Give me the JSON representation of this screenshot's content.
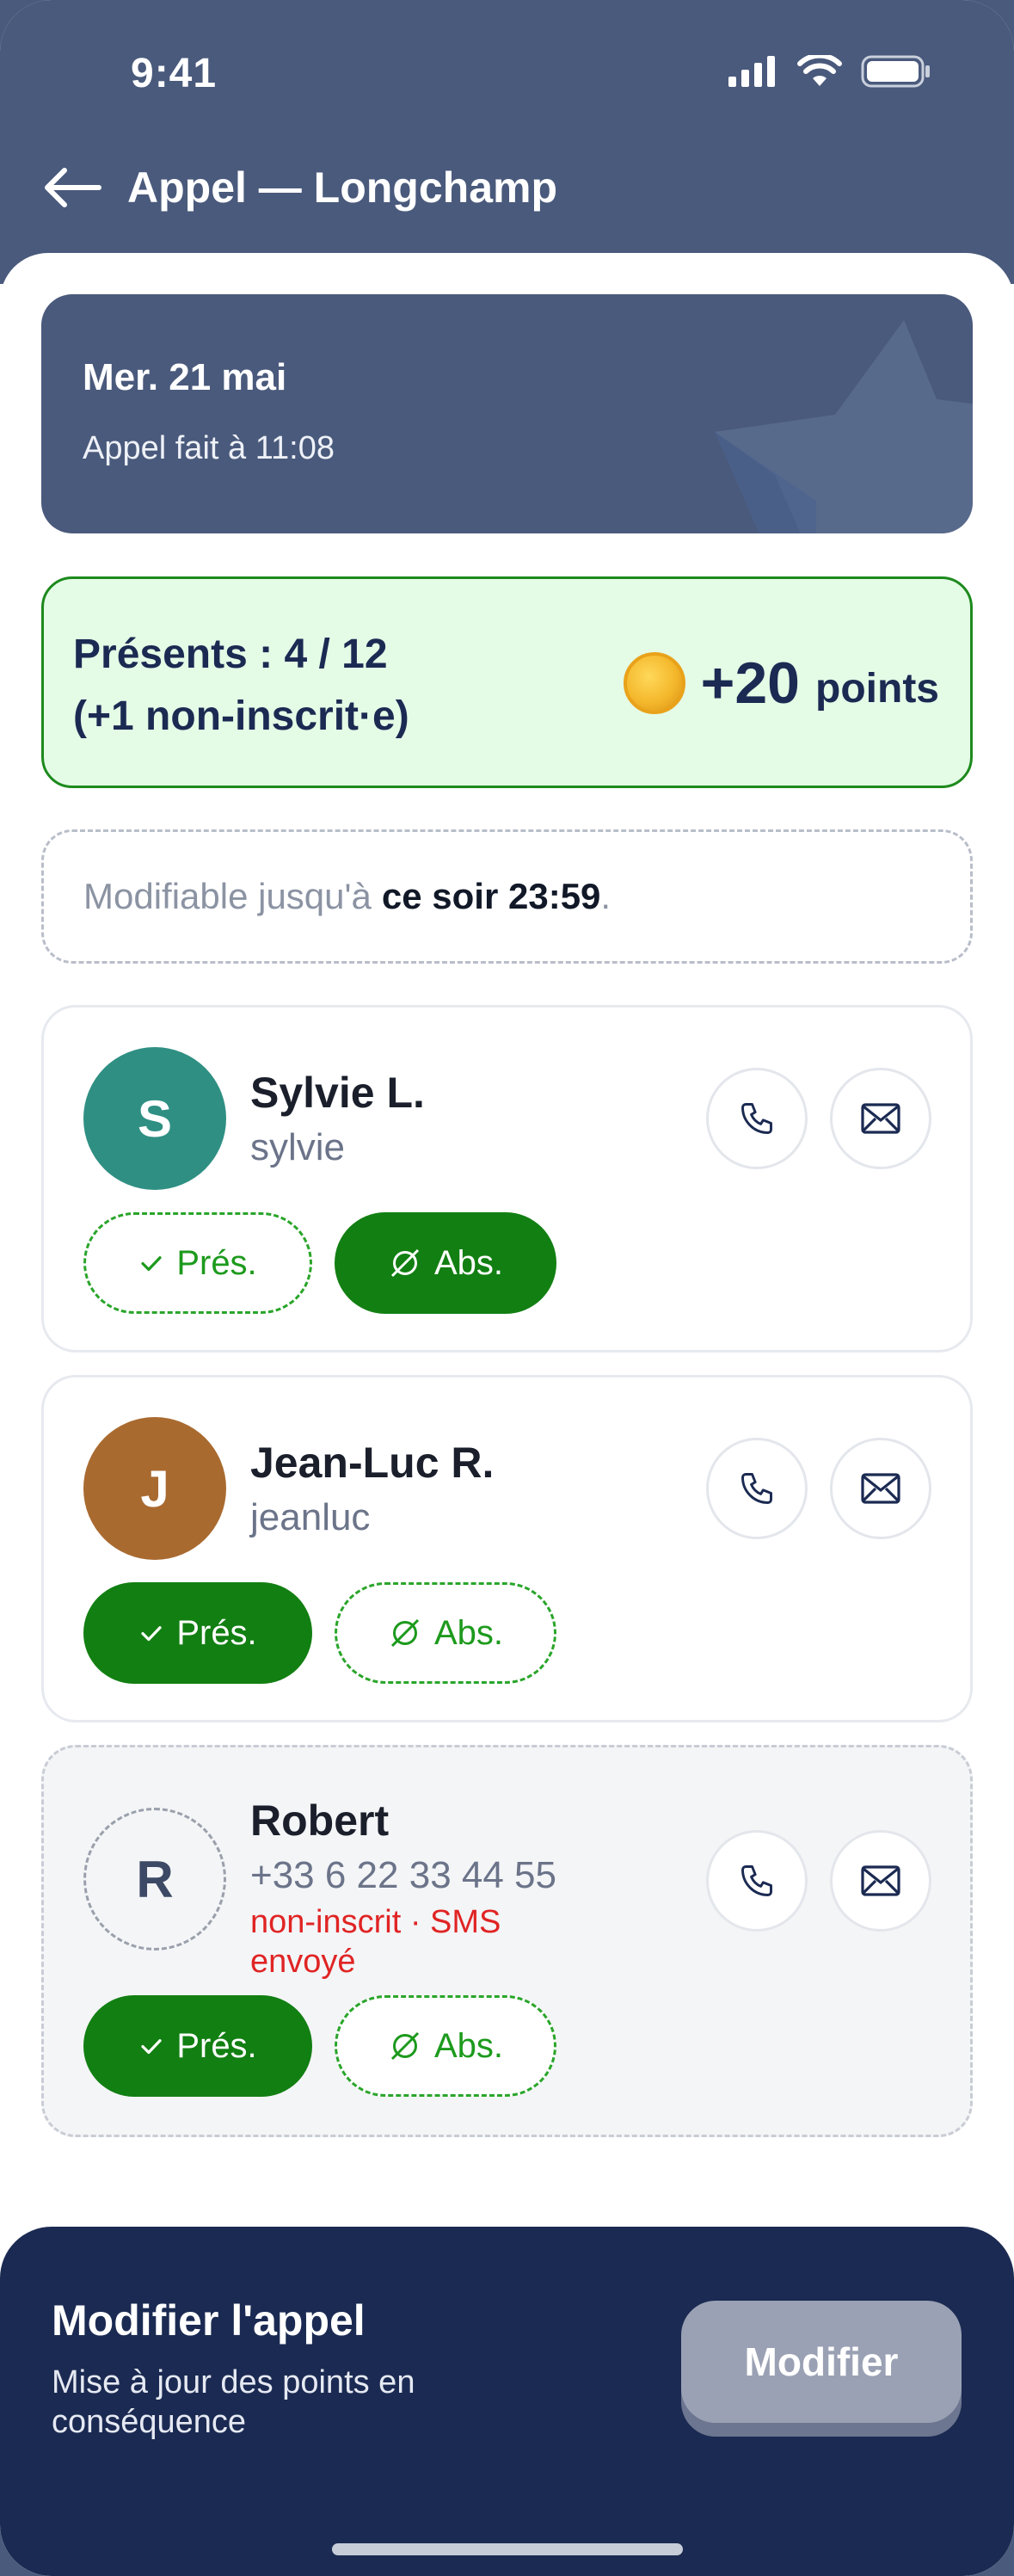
{
  "status_bar": {
    "time": "9:41"
  },
  "header": {
    "title": "Appel — Longchamp"
  },
  "date_card": {
    "date": "Mer. 21 mai",
    "subtitle": "Appel fait à 11:08"
  },
  "summary": {
    "present_line": "Présents : 4 / 12",
    "extra_line": "(+1 non-inscrit·e)",
    "points_value": "+20",
    "points_unit": "points"
  },
  "note": {
    "prefix": "Modifiable jusqu'à",
    "deadline": "ce soir 23:59",
    "suffix": "."
  },
  "people": [
    {
      "initial": "S",
      "name": "Sylvie L.",
      "handle": "sylvie",
      "status": "absent",
      "avatar_color": "#2f8f83"
    },
    {
      "initial": "J",
      "name": "Jean-Luc R.",
      "handle": "jeanluc",
      "status": "present",
      "avatar_color": "#a96a30"
    },
    {
      "initial": "R",
      "name": "Robert",
      "handle": "+33 6 22 33 44 55",
      "warning": "non-inscrit · SMS envoyé",
      "status": "present"
    }
  ],
  "buttons": {
    "present": "Prés.",
    "absent": "Abs."
  },
  "sheet": {
    "title": "Modifier l'appel",
    "subtitle": "Mise à jour des points en conséquence",
    "button": "Modifier"
  },
  "colors": {
    "header_bg": "#4a5a7c",
    "accent_green": "#127f12",
    "sheet_bg": "#1b2a52",
    "warning_red": "#e02424"
  }
}
